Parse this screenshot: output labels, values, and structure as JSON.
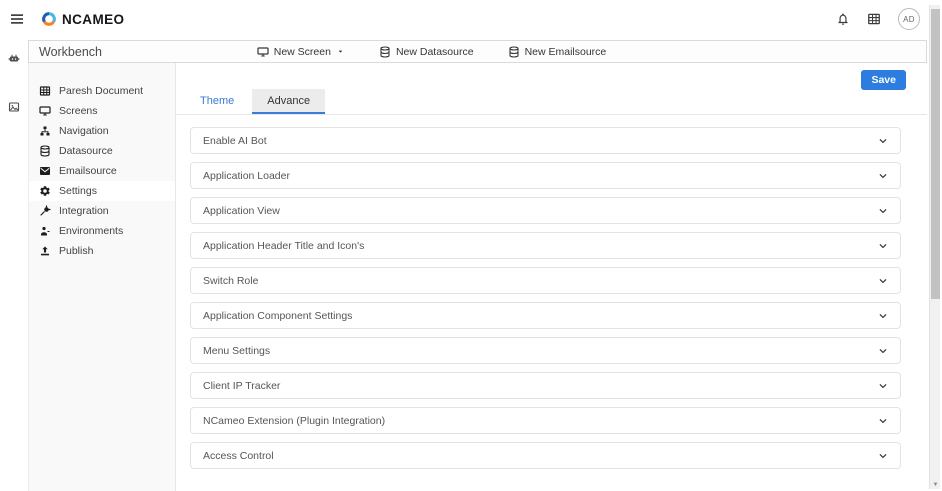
{
  "header": {
    "brand": "NCAMEO",
    "avatar_initials": "AD"
  },
  "workbench": {
    "title": "Workbench",
    "actions": [
      {
        "label": "New Screen",
        "icon": "monitor-icon",
        "caret": true
      },
      {
        "label": "New Datasource",
        "icon": "database-icon",
        "caret": false
      },
      {
        "label": "New Emailsource",
        "icon": "database-icon",
        "caret": false
      }
    ]
  },
  "sidebar": {
    "items": [
      {
        "label": "Paresh Document",
        "icon": "grid-icon",
        "active": false
      },
      {
        "label": "Screens",
        "icon": "monitor-icon",
        "active": false
      },
      {
        "label": "Navigation",
        "icon": "sitemap-icon",
        "active": false
      },
      {
        "label": "Datasource",
        "icon": "database-icon",
        "active": false
      },
      {
        "label": "Emailsource",
        "icon": "envelope-icon",
        "active": false
      },
      {
        "label": "Settings",
        "icon": "gear-icon",
        "active": true
      },
      {
        "label": "Integration",
        "icon": "plug-icon",
        "active": false
      },
      {
        "label": "Environments",
        "icon": "person-icon",
        "active": false
      },
      {
        "label": "Publish",
        "icon": "upload-icon",
        "active": false
      }
    ]
  },
  "main": {
    "save_label": "Save",
    "tabs": [
      {
        "label": "Theme",
        "active": false
      },
      {
        "label": "Advance",
        "active": true
      }
    ],
    "accordions": [
      "Enable AI Bot",
      "Application Loader",
      "Application View",
      "Application Header Title and Icon's",
      "Switch Role",
      "Application Component Settings",
      "Menu Settings",
      "Client IP Tracker",
      "NCameo Extension (Plugin Integration)",
      "Access Control"
    ]
  },
  "colors": {
    "accent_blue": "#2d7ce0",
    "tab_underline": "#3a7bd5",
    "logo_dark_blue": "#1d5fad",
    "logo_light_blue": "#45b6e8",
    "logo_orange": "#f58320"
  }
}
